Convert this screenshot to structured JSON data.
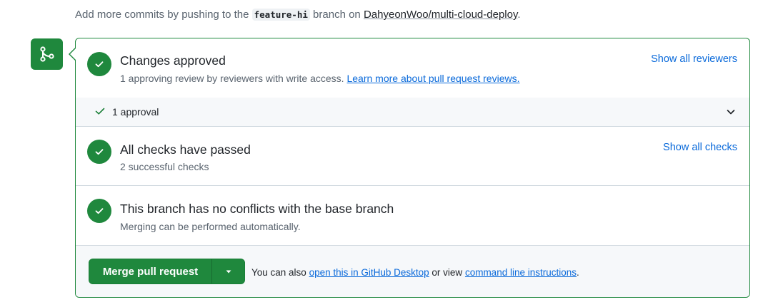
{
  "intro": {
    "prefix": "Add more commits by pushing to the ",
    "branch": "feature-hi",
    "middle": " branch on ",
    "repo": "DahyeonWoo/multi-cloud-deploy",
    "suffix": "."
  },
  "review": {
    "title": "Changes approved",
    "subtitle": "1 approving review by reviewers with write access. ",
    "learn_link": "Learn more about pull request reviews.",
    "show_link": "Show all reviewers",
    "approvals_label": "1 approval"
  },
  "checks": {
    "title": "All checks have passed",
    "subtitle": "2 successful checks",
    "show_link": "Show all checks"
  },
  "conflicts": {
    "title": "This branch has no conflicts with the base branch",
    "subtitle": "Merging can be performed automatically."
  },
  "merge": {
    "button_label": "Merge pull request",
    "note_prefix": "You can also ",
    "desktop_link": "open this in GitHub Desktop",
    "note_middle": " or view ",
    "cli_link": "command line instructions",
    "note_suffix": "."
  },
  "colors": {
    "success": "#1f883d",
    "link": "#0969da",
    "muted": "#59636e"
  },
  "icons": [
    "git-merge-icon",
    "check-icon",
    "chevron-down-icon",
    "triangle-down-icon"
  ]
}
